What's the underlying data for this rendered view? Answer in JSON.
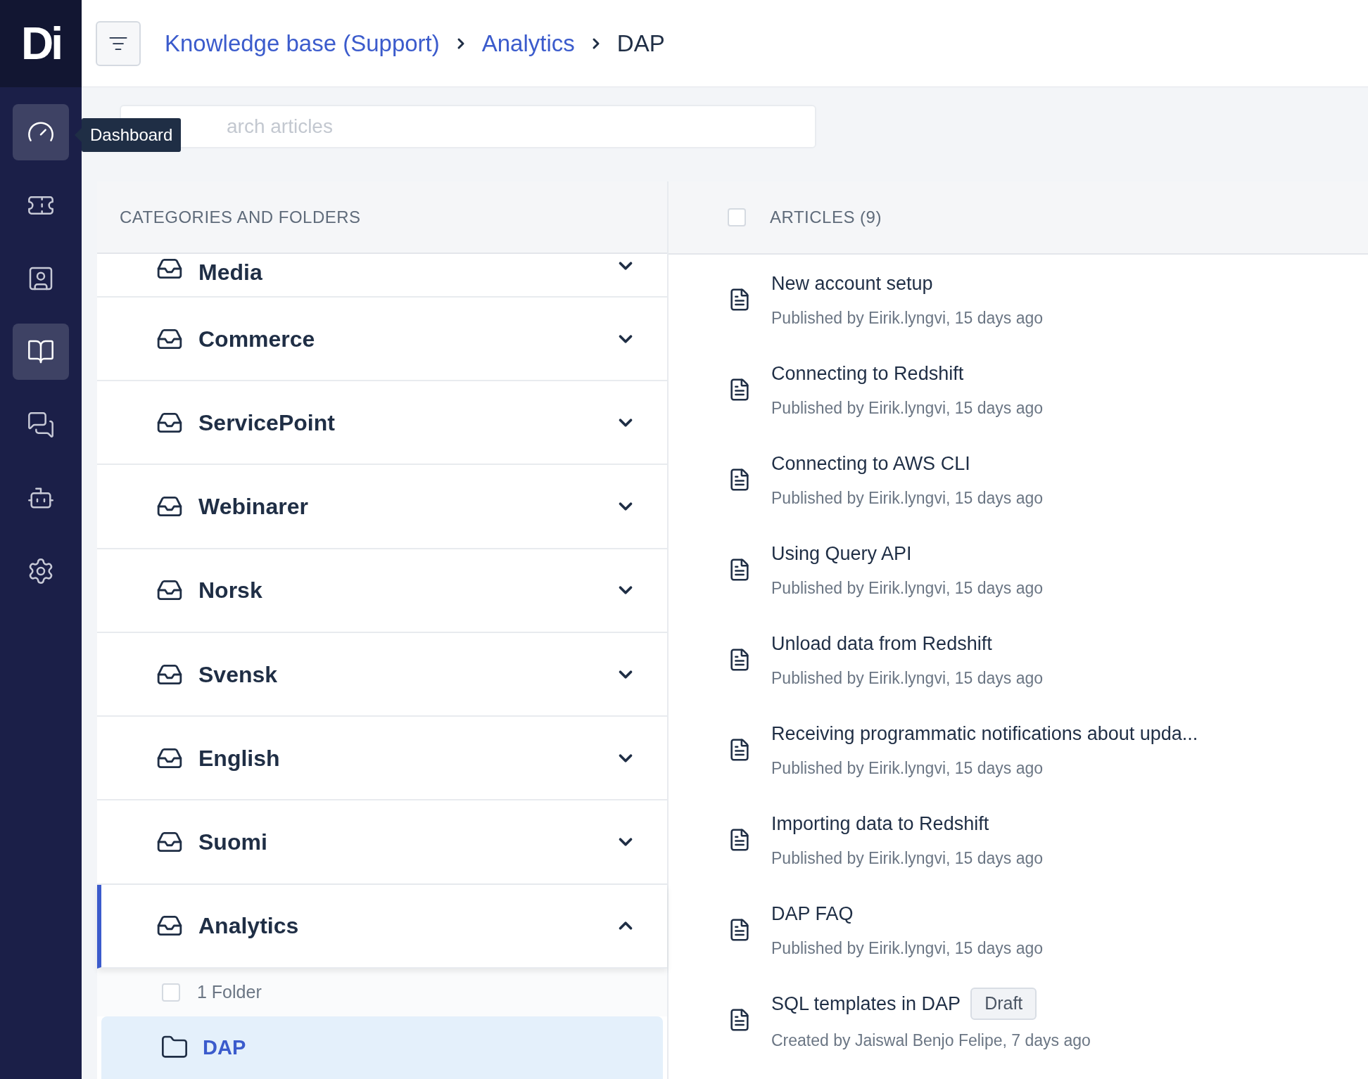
{
  "logo": {
    "text": "Di"
  },
  "nav": [
    {
      "highlighted": true
    },
    {
      "highlighted": false
    },
    {
      "highlighted": false
    },
    {
      "highlighted": true
    },
    {
      "highlighted": false
    },
    {
      "highlighted": false
    },
    {
      "highlighted": false
    }
  ],
  "tooltip": {
    "text": "Dashboard"
  },
  "breadcrumb": [
    {
      "label": "Knowledge base (Support)",
      "current": false
    },
    {
      "label": "Analytics",
      "current": false
    },
    {
      "label": "DAP",
      "current": true
    }
  ],
  "search": {
    "placeholder": "arch articles"
  },
  "categories_panel": {
    "title": "CATEGORIES AND FOLDERS",
    "categories": [
      {
        "label": "Media",
        "expanded": false,
        "selected": false
      },
      {
        "label": "Commerce",
        "expanded": false,
        "selected": false
      },
      {
        "label": "ServicePoint",
        "expanded": false,
        "selected": false
      },
      {
        "label": "Webinarer",
        "expanded": false,
        "selected": false
      },
      {
        "label": "Norsk",
        "expanded": false,
        "selected": false
      },
      {
        "label": "Svensk",
        "expanded": false,
        "selected": false
      },
      {
        "label": "English",
        "expanded": false,
        "selected": false
      },
      {
        "label": "Suomi",
        "expanded": false,
        "selected": false
      },
      {
        "label": "Analytics",
        "expanded": true,
        "selected": true,
        "folder_count": {
          "text": "1 Folder",
          "checked": false
        },
        "folders": [
          {
            "label": "DAP",
            "selected": true
          }
        ]
      }
    ]
  },
  "articles_panel": {
    "title": "ARTICLES (9)",
    "checked": false,
    "articles": [
      {
        "title": "New account setup",
        "meta": "Published by Eirik.lyngvi, 15 days ago"
      },
      {
        "title": "Connecting to Redshift",
        "meta": "Published by Eirik.lyngvi, 15 days ago"
      },
      {
        "title": "Connecting to AWS CLI",
        "meta": "Published by Eirik.lyngvi, 15 days ago"
      },
      {
        "title": "Using Query API",
        "meta": "Published by Eirik.lyngvi, 15 days ago"
      },
      {
        "title": "Unload data from Redshift",
        "meta": "Published by Eirik.lyngvi, 15 days ago"
      },
      {
        "title": "Receiving programmatic notifications about upda...",
        "meta": "Published by Eirik.lyngvi, 15 days ago"
      },
      {
        "title": "Importing data to Redshift",
        "meta": "Published by Eirik.lyngvi, 15 days ago"
      },
      {
        "title": "DAP FAQ",
        "meta": "Published by Eirik.lyngvi, 15 days ago"
      },
      {
        "title": "SQL templates in DAP",
        "meta": "Created by Jaiswal Benjo Felipe, 7 days ago",
        "badge": "Draft"
      }
    ]
  }
}
